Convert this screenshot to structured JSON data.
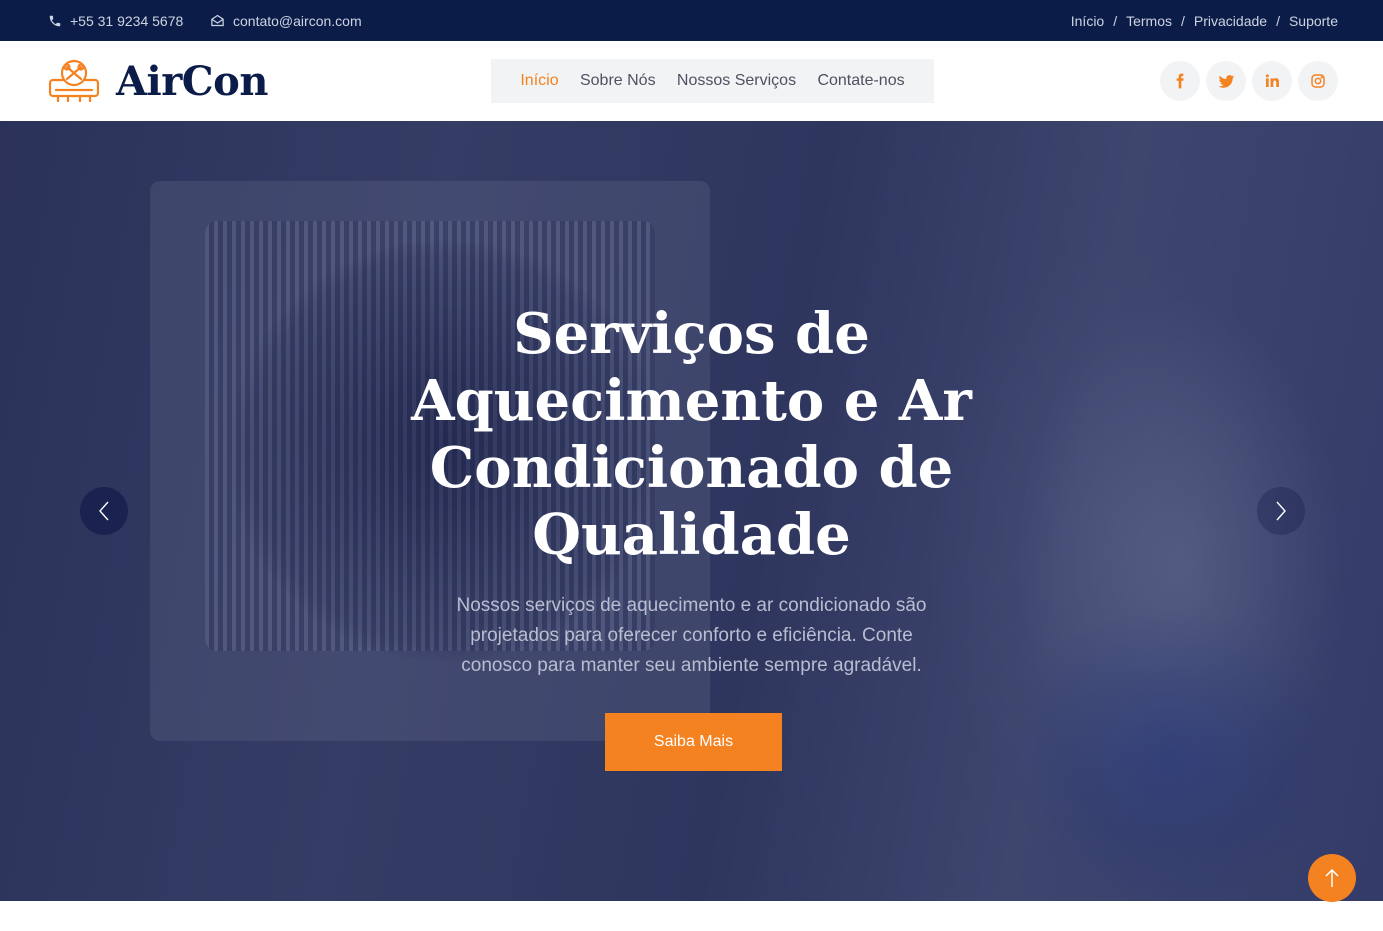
{
  "topbar": {
    "phone": "+55 31 9234 5678",
    "email": "contato@aircon.com",
    "links": [
      "Início",
      "Termos",
      "Privacidade",
      "Suporte"
    ],
    "separator": "/"
  },
  "header": {
    "brand": "AirCon",
    "nav": [
      {
        "label": "Início",
        "active": true
      },
      {
        "label": "Sobre Nós",
        "active": false
      },
      {
        "label": "Nossos Serviços",
        "active": false
      },
      {
        "label": "Contate-nos",
        "active": false
      }
    ],
    "social_icons": [
      "facebook-icon",
      "twitter-icon",
      "linkedin-icon",
      "instagram-icon"
    ]
  },
  "hero": {
    "title": "Serviços de Aquecimento e Ar Condicionado de Qualidade",
    "text": "Nossos serviços de aquecimento e ar condicionado são projetados para oferecer conforto e eficiência. Conte conosco para manter seu ambiente sempre agradável.",
    "button": "Saiba Mais"
  },
  "colors": {
    "accent": "#f58220",
    "navy": "#0b1c48",
    "nav_bg": "#f2f3f5"
  }
}
